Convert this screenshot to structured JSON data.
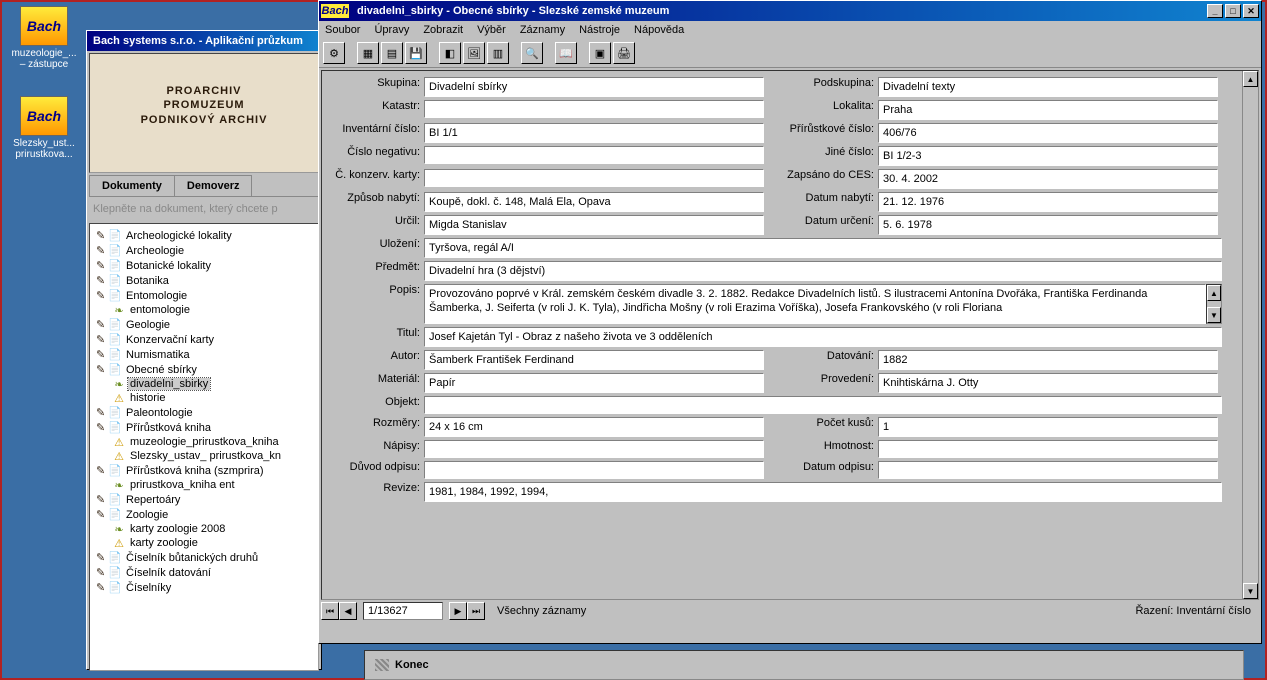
{
  "desktop": [
    {
      "label": "muzeologie_...\n– zástupce"
    },
    {
      "label": "Slezsky_ust...\nprirustkova..."
    }
  ],
  "explorer": {
    "title": "Bach systems s.r.o. - Aplikační průzkum",
    "banner": [
      "PROARCHIV",
      "PROMUZEUM",
      "PODNIKOVÝ ARCHIV"
    ],
    "tabs": [
      "Dokumenty",
      "Demoverz"
    ],
    "hint": "Klepněte na dokument, který chcete p",
    "tree": [
      {
        "lvl": 1,
        "ico": "doc",
        "label": "Archeologické lokality"
      },
      {
        "lvl": 1,
        "ico": "doc",
        "label": "Archeologie"
      },
      {
        "lvl": 1,
        "ico": "doc",
        "label": "Botanické lokality"
      },
      {
        "lvl": 1,
        "ico": "doc",
        "label": "Botanika"
      },
      {
        "lvl": 1,
        "ico": "doc",
        "label": "Entomologie"
      },
      {
        "lvl": 2,
        "ico": "leaf",
        "label": "entomologie"
      },
      {
        "lvl": 1,
        "ico": "doc",
        "label": "Geologie"
      },
      {
        "lvl": 1,
        "ico": "doc",
        "label": "Konzervační karty"
      },
      {
        "lvl": 1,
        "ico": "doc",
        "label": "Numismatika"
      },
      {
        "lvl": 1,
        "ico": "doc",
        "label": "Obecné sbírky"
      },
      {
        "lvl": 2,
        "ico": "leaf",
        "label": "divadelni_sbirky",
        "sel": true
      },
      {
        "lvl": 2,
        "ico": "warn",
        "label": "historie"
      },
      {
        "lvl": 1,
        "ico": "doc",
        "label": "Paleontologie"
      },
      {
        "lvl": 1,
        "ico": "doc",
        "label": "Přírůstková kniha"
      },
      {
        "lvl": 2,
        "ico": "warn",
        "label": "muzeologie_prirustkova_kniha"
      },
      {
        "lvl": 2,
        "ico": "warn",
        "label": "Slezsky_ustav_ prirustkova_kn"
      },
      {
        "lvl": 1,
        "ico": "doc",
        "label": "Přírůstková kniha (szmprira)"
      },
      {
        "lvl": 2,
        "ico": "leaf",
        "label": "prirustkova_kniha ent"
      },
      {
        "lvl": 1,
        "ico": "doc",
        "label": "Repertoáry"
      },
      {
        "lvl": 1,
        "ico": "doc",
        "label": "Zoologie"
      },
      {
        "lvl": 2,
        "ico": "leaf",
        "label": "karty zoologie 2008"
      },
      {
        "lvl": 2,
        "ico": "warn",
        "label": "karty zoologie"
      },
      {
        "lvl": 1,
        "ico": "doc",
        "label": "Číselník bůtanických druhů"
      },
      {
        "lvl": 1,
        "ico": "doc",
        "label": "Číselník datování"
      },
      {
        "lvl": 1,
        "ico": "doc",
        "label": "Číselníky"
      }
    ]
  },
  "record": {
    "title": "divadelni_sbirky - Obecné sbírky - Slezské zemské muzeum",
    "menu": [
      "Soubor",
      "Úpravy",
      "Zobrazit",
      "Výběr",
      "Záznamy",
      "Nástroje",
      "Nápověda"
    ],
    "fields": {
      "skupina_lbl": "Skupina:",
      "skupina": "Divadelní sbírky",
      "podskupina_lbl": "Podskupina:",
      "podskupina": "Divadelní texty",
      "katastr_lbl": "Katastr:",
      "katastr": "",
      "lokalita_lbl": "Lokalita:",
      "lokalita": "Praha",
      "inv_lbl": "Inventární číslo:",
      "inv": "BI 1/1",
      "prirust_lbl": "Přírůstkové číslo:",
      "prirust": "406/76",
      "neg_lbl": "Číslo negativu:",
      "neg": "",
      "jine_lbl": "Jiné číslo:",
      "jine": "BI 1/2-3",
      "konzerv_lbl": "Č. konzerv. karty:",
      "konzerv": "",
      "ces_lbl": "Zapsáno do CES:",
      "ces": "30. 4. 2002",
      "zpusob_lbl": "Způsob nabytí:",
      "zpusob": "Koupě, dokl. č. 148, Malá Ela, Opava",
      "nabyti_lbl": "Datum nabytí:",
      "nabyti": "21. 12. 1976",
      "urcil_lbl": "Určil:",
      "urcil": "Migda Stanislav",
      "urceni_lbl": "Datum určení:",
      "urceni": "5. 6. 1978",
      "ulozeni_lbl": "Uložení:",
      "ulozeni": "Tyršova, regál A/I",
      "predmet_lbl": "Předmět:",
      "predmet": "Divadelní hra (3 dějství)",
      "popis_lbl": "Popis:",
      "popis": "Provozováno poprvé v Král. zemském českém divadle 3. 2. 1882. Redakce Divadelních listů. S ilustracemi Antonína Dvořáka, Františka Ferdinanda Šamberka, J. Seiferta (v roli J. K. Tyla), Jindřicha Mošny (v roli Erazima Voříška), Josefa Frankovského (v roli Floriana",
      "titul_lbl": "Titul:",
      "titul": "Josef Kajetán Tyl - Obraz z našeho života ve 3 odděleních",
      "autor_lbl": "Autor:",
      "autor": "Šamberk František Ferdinand",
      "datovani_lbl": "Datování:",
      "datovani": "1882",
      "material_lbl": "Materiál:",
      "material": "Papír",
      "provedeni_lbl": "Provedení:",
      "provedeni": "Knihtiskárna J. Otty",
      "objekt_lbl": "Objekt:",
      "objekt": "",
      "rozmery_lbl": "Rozměry:",
      "rozmery": "24 x 16 cm",
      "pocet_lbl": "Počet kusů:",
      "pocet": "1",
      "napisy_lbl": "Nápisy:",
      "napisy": "",
      "hmotnost_lbl": "Hmotnost:",
      "hmotnost": "",
      "duvodr_lbl": "Důvod odpisu:",
      "duvodr": "",
      "datumodp_lbl": "Datum odpisu:",
      "datumodp": "",
      "revize_lbl": "Revize:",
      "revize": "1981, 1984, 1992, 1994,"
    },
    "nav": {
      "pos": "1/13627",
      "status": "Všechny záznamy",
      "sort": "Řazení: Inventární číslo"
    }
  },
  "konec": "Konec"
}
